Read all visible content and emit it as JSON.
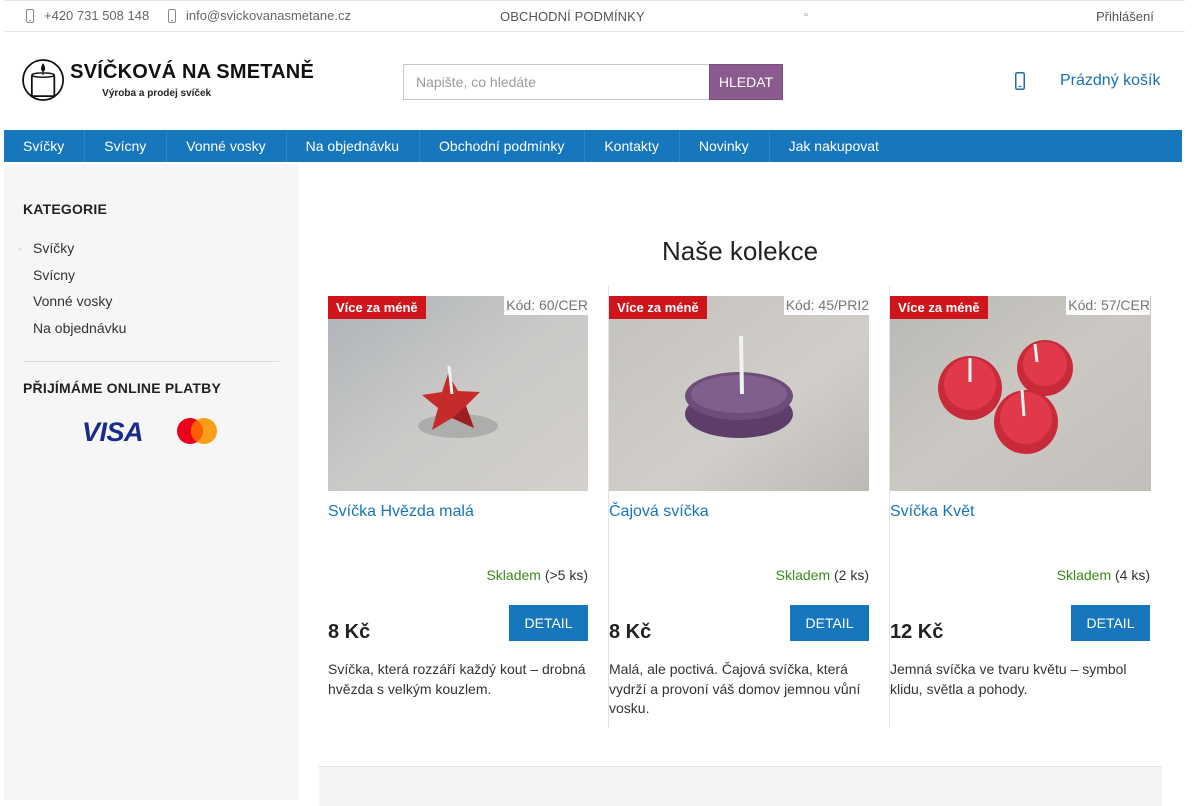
{
  "topbar": {
    "phone": "+420 731 508 148",
    "email": "info@svickovanasmetane.cz",
    "terms_link": "OBCHODNÍ PODMÍNKY",
    "login": "Přihlášení",
    "icons": [
      "phone-icon",
      "mail-icon",
      "dot-icon"
    ]
  },
  "header": {
    "logo_title": "SVÍČKOVÁ NA SMETANĚ",
    "logo_tagline": "Výroba a prodej svíček",
    "search_placeholder": "Napište, co hledáte",
    "search_button": "HLEDAT",
    "cart_label": "Prázdný košík"
  },
  "nav": {
    "items": [
      {
        "label": "Svíčky"
      },
      {
        "label": "Svícny"
      },
      {
        "label": "Vonné vosky"
      },
      {
        "label": "Na objednávku"
      },
      {
        "label": "Obchodní podmínky"
      },
      {
        "label": "Kontakty"
      },
      {
        "label": "Novinky"
      },
      {
        "label": "Jak nakupovat"
      }
    ]
  },
  "sidebar": {
    "categories_title": "KATEGORIE",
    "categories": [
      {
        "label": "Svíčky"
      },
      {
        "label": "Svícny"
      },
      {
        "label": "Vonné vosky"
      },
      {
        "label": "Na objednávku"
      }
    ],
    "payments_title": "PŘIJÍMÁME ONLINE PLATBY",
    "payment_visa": "VISA"
  },
  "main": {
    "title": "Naše kolekce",
    "products": [
      {
        "badge": "Více za méně",
        "code": "Kód: 60/CER",
        "name": "Svíčka Hvězda malá",
        "stock_status": "Skladem",
        "stock_qty": "(>5 ks)",
        "price": "8 Kč",
        "detail": "DETAIL",
        "description": "Svíčka, která rozzáří každý kout – drobná hvězda s velkým kouzlem."
      },
      {
        "badge": "Více za méně",
        "code": "Kód: 45/PRI2",
        "name": "Čajová svíčka",
        "stock_status": "Skladem",
        "stock_qty": "(2 ks)",
        "price": "8 Kč",
        "detail": "DETAIL",
        "description": "Malá, ale poctivá. Čajová svíčka, která vydrží a provoní váš domov jemnou vůní vosku."
      },
      {
        "badge": "Více za méně",
        "code": "Kód: 57/CER",
        "name": "Svíčka Květ",
        "stock_status": "Skladem",
        "stock_qty": "(4 ks)",
        "price": "12 Kč",
        "detail": "DETAIL",
        "description": "Jemná svíčka ve tvaru květu – symbol klidu, světla a pohody."
      }
    ]
  },
  "colors": {
    "nav_blue": "#1777bd",
    "search_button": "#8b5a8e",
    "badge_red": "#d0141b",
    "stock_green": "#3a8a1e",
    "link_blue": "#1a73b9"
  }
}
